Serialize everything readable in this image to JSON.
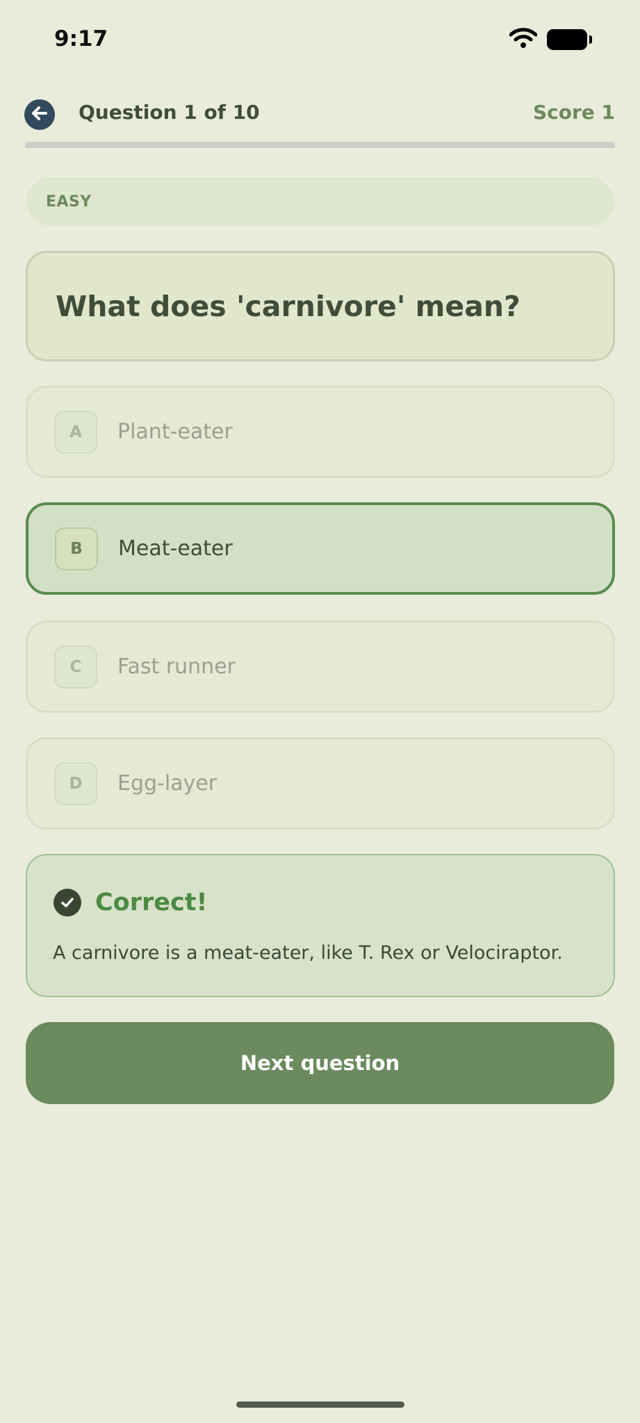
{
  "status_bar": {
    "time": "9:17"
  },
  "header": {
    "question_counter": "Question 1 of 10",
    "score_label": "Score",
    "score_value": "1"
  },
  "difficulty": "EASY",
  "question": "What does 'carnivore' mean?",
  "options": [
    {
      "letter": "A",
      "label": "Plant-eater"
    },
    {
      "letter": "B",
      "label": "Meat-eater",
      "selected": true
    },
    {
      "letter": "C",
      "label": "Fast runner"
    },
    {
      "letter": "D",
      "label": "Egg-layer"
    }
  ],
  "feedback": {
    "title": "Correct!",
    "text": "A carnivore is a meat-eater, like T. Rex or Velociraptor."
  },
  "next_button_label": "Next question",
  "colors": {
    "background": "#e9ecda",
    "accent_green": "#6b8a5d",
    "correct_border": "#5a8b50",
    "back_button": "#324a5c"
  },
  "icons": {
    "back": "arrow-left-icon",
    "check": "check-circle-icon",
    "wifi": "wifi-icon",
    "battery": "battery-icon"
  }
}
